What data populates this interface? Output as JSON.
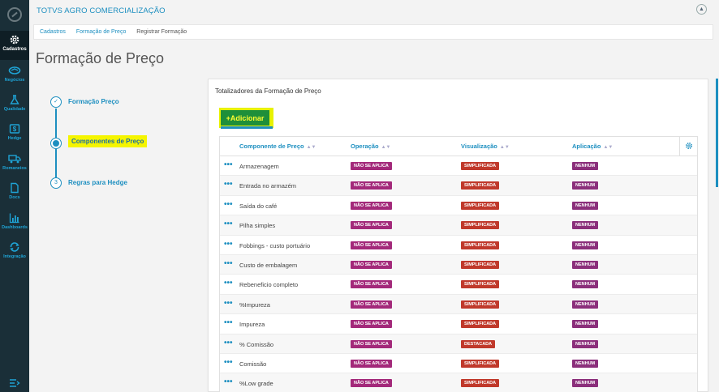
{
  "app": {
    "title": "TOTVS AGRO COMERCIALIZAÇÃO"
  },
  "sidebar": {
    "items": [
      {
        "label": "Cadastros",
        "icon": "gear-icon",
        "active": true
      },
      {
        "label": "Negócios",
        "icon": "handshake-icon"
      },
      {
        "label": "Qualidade",
        "icon": "flask-icon"
      },
      {
        "label": "Hedge",
        "icon": "dollar-icon"
      },
      {
        "label": "Romaneios",
        "icon": "truck-icon"
      },
      {
        "label": "Docs",
        "icon": "document-icon"
      },
      {
        "label": "Dashboards",
        "icon": "bar-chart-icon"
      },
      {
        "label": "Integração",
        "icon": "sync-icon"
      }
    ]
  },
  "breadcrumb": [
    "Cadastros",
    "Formação de Preço",
    "Registrar Formação"
  ],
  "page": {
    "title": "Formação de Preço"
  },
  "stepper": {
    "steps": [
      {
        "label": "Formação Preço",
        "marker": "✓"
      },
      {
        "label": "Componentes de Preço",
        "marker": ""
      },
      {
        "label": "Regras para Hedge",
        "marker": "3"
      }
    ]
  },
  "panel": {
    "title": "Totalizadores da Formação de Preço",
    "add_label": "+Adicionar",
    "columns": [
      "Componente de Preço",
      "Operação",
      "Visualização",
      "Aplicação"
    ],
    "rows": [
      {
        "name": "Armazenagem",
        "operacao": "NÃO SE APLICA",
        "visualizacao": "SIMPLIFICADA",
        "aplicacao": "NENHUM"
      },
      {
        "name": "Entrada no armazém",
        "operacao": "NÃO SE APLICA",
        "visualizacao": "SIMPLIFICADA",
        "aplicacao": "NENHUM"
      },
      {
        "name": "Saída do café",
        "operacao": "NÃO SE APLICA",
        "visualizacao": "SIMPLIFICADA",
        "aplicacao": "NENHUM"
      },
      {
        "name": "Pilha simples",
        "operacao": "NÃO SE APLICA",
        "visualizacao": "SIMPLIFICADA",
        "aplicacao": "NENHUM"
      },
      {
        "name": "Fobbings - custo portuário",
        "operacao": "NÃO SE APLICA",
        "visualizacao": "SIMPLIFICADA",
        "aplicacao": "NENHUM"
      },
      {
        "name": "Custo de embalagem",
        "operacao": "NÃO SE APLICA",
        "visualizacao": "SIMPLIFICADA",
        "aplicacao": "NENHUM"
      },
      {
        "name": "Rebeneficio completo",
        "operacao": "NÃO SE APLICA",
        "visualizacao": "SIMPLIFICADA",
        "aplicacao": "NENHUM"
      },
      {
        "name": "%Impureza",
        "operacao": "NÃO SE APLICA",
        "visualizacao": "SIMPLIFICADA",
        "aplicacao": "NENHUM"
      },
      {
        "name": "Impureza",
        "operacao": "NÃO SE APLICA",
        "visualizacao": "SIMPLIFICADA",
        "aplicacao": "NENHUM"
      },
      {
        "name": "% Comissão",
        "operacao": "NÃO SE APLICA",
        "visualizacao": "DESTACADA",
        "aplicacao": "NENHUM"
      },
      {
        "name": "Comissão",
        "operacao": "NÃO SE APLICA",
        "visualizacao": "SIMPLIFICADA",
        "aplicacao": "NENHUM"
      },
      {
        "name": "%Low grade",
        "operacao": "NÃO SE APLICA",
        "visualizacao": "SIMPLIFICADA",
        "aplicacao": "NENHUM"
      }
    ]
  },
  "colors": {
    "accent": "#1d8fc0",
    "sidebar": "#1a2f38",
    "highlight": "#f5f500",
    "operacao_badge": "#a3297a",
    "visualizacao_badge": "#c0392b",
    "aplicacao_badge": "#8b2f7b"
  }
}
